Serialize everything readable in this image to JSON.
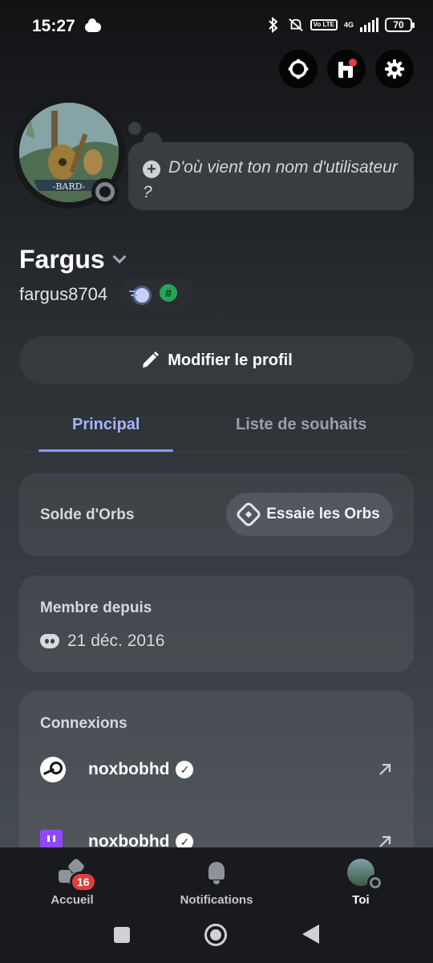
{
  "status_bar": {
    "time": "15:27",
    "network": "4G",
    "volte": "Vo LTE",
    "battery": "70"
  },
  "top_buttons": [
    "nitro-icon",
    "shop-icon",
    "settings-icon"
  ],
  "profile": {
    "display_name": "Fargus",
    "username": "fargus8704",
    "avatar_caption": "-BARD-",
    "bio_prompt": "D'où vient ton nom d'utilisateur ?",
    "badge_hash": "#"
  },
  "edit_button": {
    "label": "Modifier le profil"
  },
  "tabs": [
    {
      "label": "Principal",
      "active": true
    },
    {
      "label": "Liste de souhaits",
      "active": false
    }
  ],
  "orbs": {
    "label": "Solde d'Orbs",
    "button": "Essaie les Orbs"
  },
  "member": {
    "label": "Membre depuis",
    "date": "21 déc. 2016"
  },
  "connections": {
    "label": "Connexions",
    "items": [
      {
        "service": "steam-icon",
        "name": "noxbobhd",
        "verified": true
      },
      {
        "service": "twitch-icon",
        "name": "noxbobhd",
        "verified": true
      }
    ]
  },
  "bottom_nav": {
    "items": [
      {
        "label": "Accueil",
        "badge": "16",
        "icon": "home-icon"
      },
      {
        "label": "Notifications",
        "icon": "bell-icon"
      },
      {
        "label": "Toi",
        "icon": "avatar",
        "active": true
      }
    ]
  },
  "colors": {
    "accent": "#a7b4ff",
    "badge_red": "#e13d40",
    "twitch": "#9146ff"
  }
}
